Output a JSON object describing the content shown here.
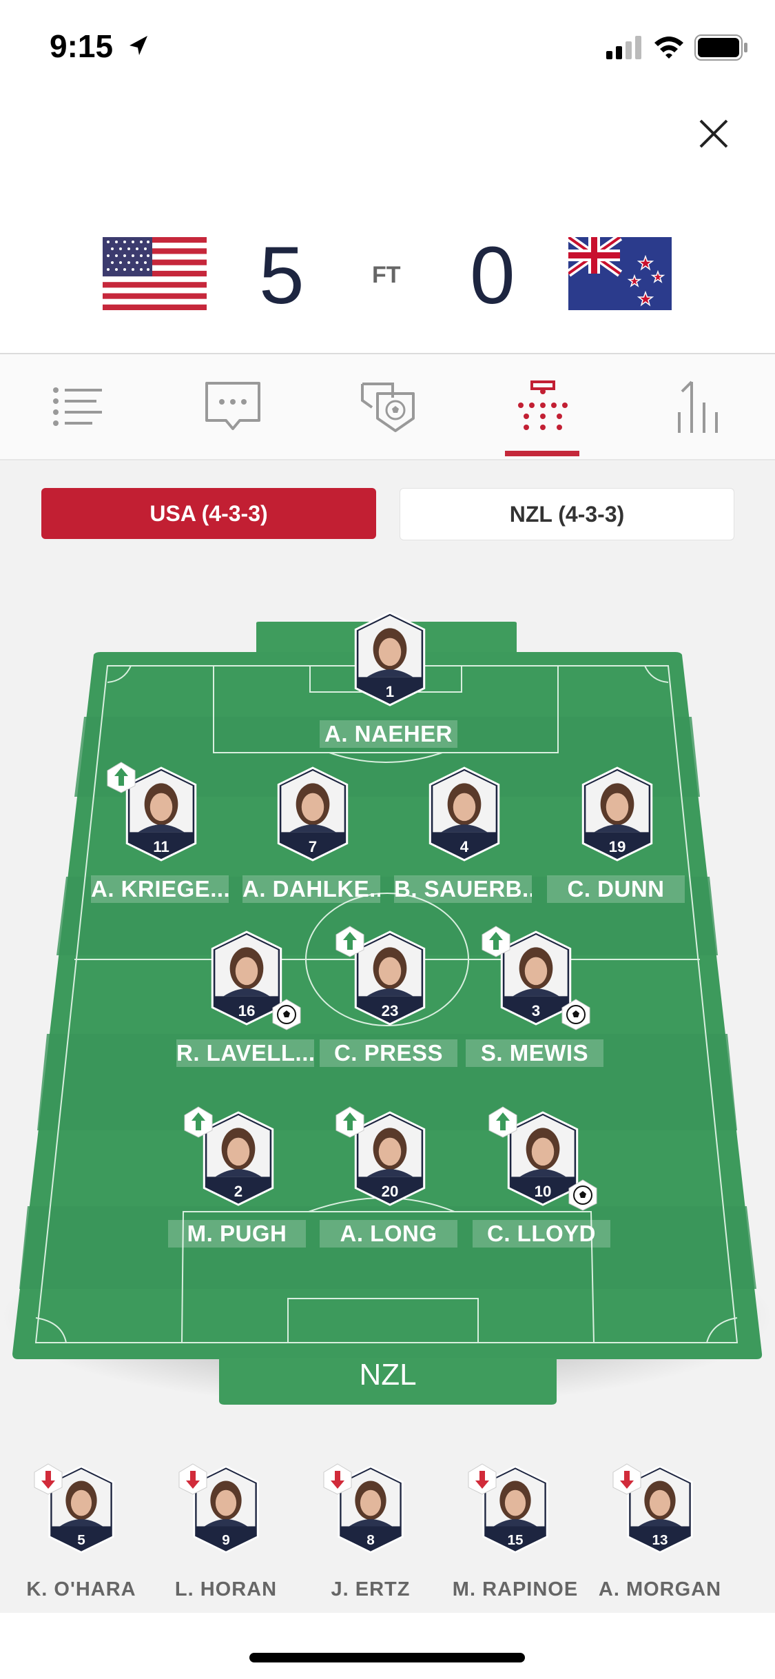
{
  "status": {
    "time": "9:15"
  },
  "match": {
    "home_score": "5",
    "status": "FT",
    "away_score": "0"
  },
  "tabs": [
    "summary-list",
    "commentary",
    "events",
    "lineups",
    "stats"
  ],
  "team_toggle": {
    "home": "USA (4-3-3)",
    "away": "NZL (4-3-3)",
    "selected": "home"
  },
  "colors": {
    "accent": "#c21f33",
    "pitch": "#3d9a5c",
    "navy": "#1d2540"
  },
  "opponent_label": "NZL",
  "lineup": [
    {
      "num": "1",
      "name": "A. NAEHER",
      "sub": false,
      "goal": false
    },
    {
      "num": "11",
      "name": "A. KRIEGE...",
      "sub": true,
      "goal": false
    },
    {
      "num": "7",
      "name": "A. DAHLKE...",
      "sub": false,
      "goal": false
    },
    {
      "num": "4",
      "name": "B. SAUERB...",
      "sub": false,
      "goal": false
    },
    {
      "num": "19",
      "name": "C. DUNN",
      "sub": false,
      "goal": false
    },
    {
      "num": "16",
      "name": "R. LAVELL...",
      "sub": false,
      "goal": true
    },
    {
      "num": "23",
      "name": "C. PRESS",
      "sub": true,
      "goal": false
    },
    {
      "num": "3",
      "name": "S. MEWIS",
      "sub": true,
      "goal": true
    },
    {
      "num": "2",
      "name": "M. PUGH",
      "sub": true,
      "goal": false
    },
    {
      "num": "20",
      "name": "A. LONG",
      "sub": true,
      "goal": false
    },
    {
      "num": "10",
      "name": "C. LLOYD",
      "sub": true,
      "goal": true
    }
  ],
  "bench": [
    {
      "num": "5",
      "name": "K. O'HARA"
    },
    {
      "num": "9",
      "name": "L. HORAN"
    },
    {
      "num": "8",
      "name": "J. ERTZ"
    },
    {
      "num": "15",
      "name": "M. RAPINOE"
    },
    {
      "num": "13",
      "name": "A. MORGAN"
    }
  ]
}
